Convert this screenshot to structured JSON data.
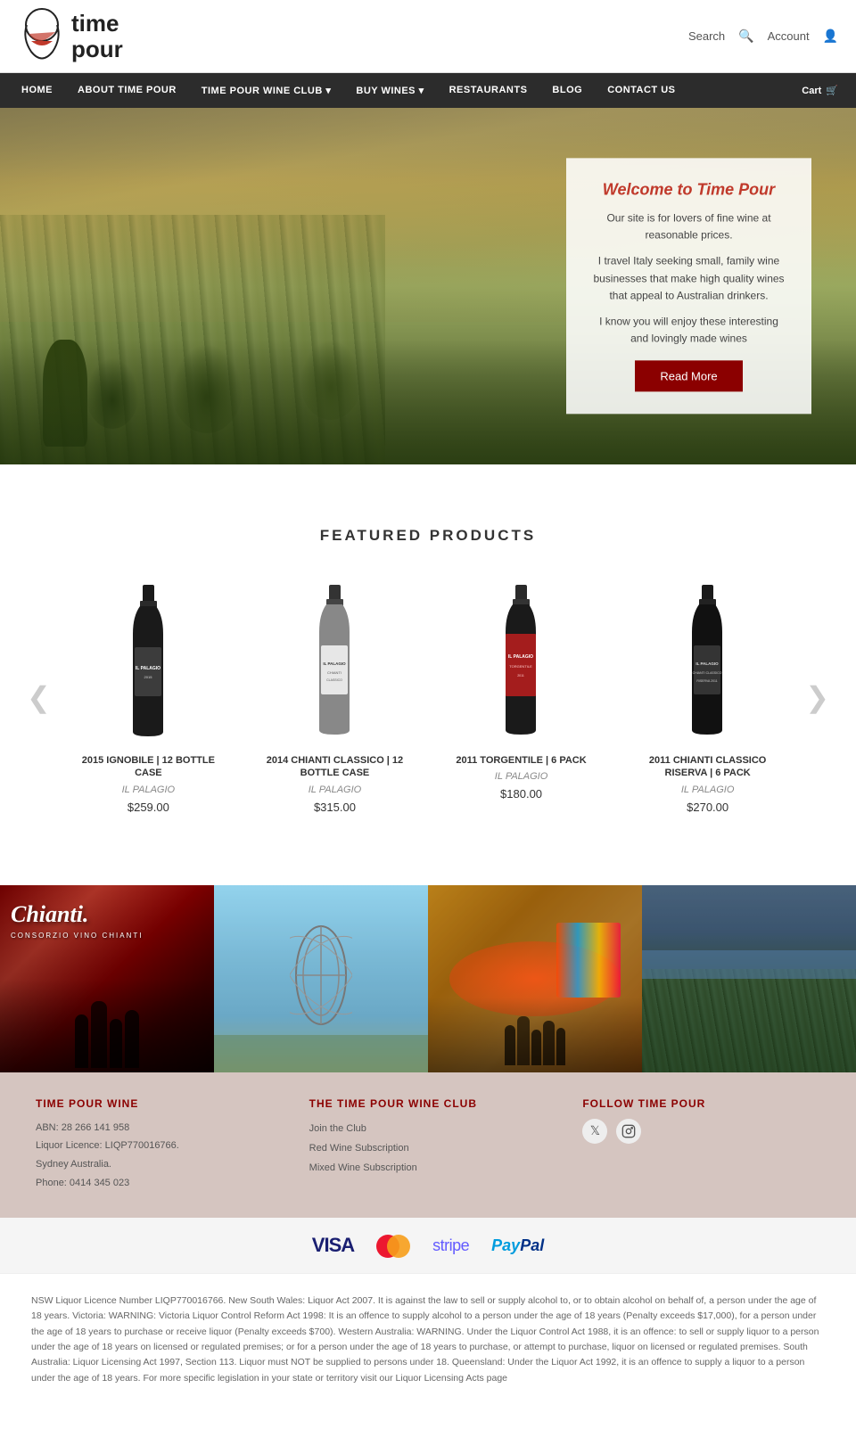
{
  "header": {
    "logo_line1": "time",
    "logo_line2": "pour",
    "search_label": "Search",
    "account_label": "Account"
  },
  "nav": {
    "items": [
      {
        "label": "HOME",
        "href": "#"
      },
      {
        "label": "ABOUT TIME POUR",
        "href": "#"
      },
      {
        "label": "TIME POUR WINE CLUB",
        "href": "#",
        "dropdown": true
      },
      {
        "label": "BUY WINES",
        "href": "#",
        "dropdown": true
      },
      {
        "label": "RESTAURANTS",
        "href": "#"
      },
      {
        "label": "BLOG",
        "href": "#"
      },
      {
        "label": "CONTACT US",
        "href": "#"
      }
    ],
    "cart_label": "Cart"
  },
  "hero": {
    "title": "Welcome to Time Pour",
    "text1": "Our site is for lovers of fine wine at reasonable prices.",
    "text2": "I travel Italy seeking small, family wine businesses that make high quality wines that appeal to Australian drinkers.",
    "text3": "I know you will enjoy these interesting and lovingly made wines",
    "btn_label": "Read More"
  },
  "featured": {
    "section_title": "FEATURED PRODUCTS",
    "prev_arrow": "❮",
    "next_arrow": "❯",
    "products": [
      {
        "name": "2015 IGNOBILE | 12 BOTTLE CASE",
        "brand": "IL PALAGIO",
        "price": "$259.00",
        "bottle_color": "#1a1a1a"
      },
      {
        "name": "2014 CHIANTI CLASSICO | 12 BOTTLE CASE",
        "brand": "IL PALAGIO",
        "price": "$315.00",
        "bottle_color": "#2a2a2a"
      },
      {
        "name": "2011 TORGENTILE | 6 PACK",
        "brand": "IL PALAGIO",
        "price": "$180.00",
        "bottle_color": "#8b0000"
      },
      {
        "name": "2011 CHIANTI CLASSICO RISERVA | 6 PACK",
        "brand": "IL PALAGIO",
        "price": "$270.00",
        "bottle_color": "#1a1a1a"
      }
    ]
  },
  "gallery": {
    "items": [
      {
        "type": "chianti",
        "main_text": "Chianti.",
        "sub_text": "CONSORZIO VINO CHIANTI"
      },
      {
        "type": "sculpture"
      },
      {
        "type": "festival"
      },
      {
        "type": "vineyard"
      }
    ]
  },
  "footer": {
    "col1": {
      "title": "TIME POUR WINE",
      "abn": "ABN: 28 266 141 958",
      "licence": "Liquor Licence: LIQP770016766.",
      "location": "Sydney Australia.",
      "phone": "Phone: 0414 345 023"
    },
    "col2": {
      "title": "THE TIME POUR WINE CLUB",
      "links": [
        "Join the Club",
        "Red Wine Subscription",
        "Mixed Wine Subscription"
      ]
    },
    "col3": {
      "title": "FOLLOW TIME POUR",
      "twitter_icon": "𝕏",
      "instagram_icon": "📷"
    }
  },
  "payment": {
    "visa": "VISA",
    "mastercard": "●●",
    "stripe": "stripe",
    "paypal": "PayPal"
  },
  "legal": {
    "text": "NSW Liquor Licence Number LIQP770016766. New South Wales: Liquor Act 2007. It is against the law to sell or supply alcohol to, or to obtain alcohol on behalf of, a person under the age of 18 years. Victoria: WARNING: Victoria Liquor Control Reform Act 1998: It is an offence to supply alcohol to a person under the age of 18 years (Penalty exceeds $17,000), for a person under the age of 18 years to purchase or receive liquor (Penalty exceeds $700). Western Australia: WARNING. Under the Liquor Control Act 1988, it is an offence: to sell or supply liquor to a person under the age of 18 years on licensed or regulated premises; or for a person under the age of 18 years to purchase, or attempt to purchase, liquor on licensed or regulated premises. South Australia: Liquor Licensing Act 1997, Section 113. Liquor must NOT be supplied to persons under 18. Queensland: Under the Liquor Act 1992, it is an offence to supply a liquor to a person under the age of 18 years. For more specific legislation in your state or territory visit our Liquor Licensing Acts page"
  }
}
